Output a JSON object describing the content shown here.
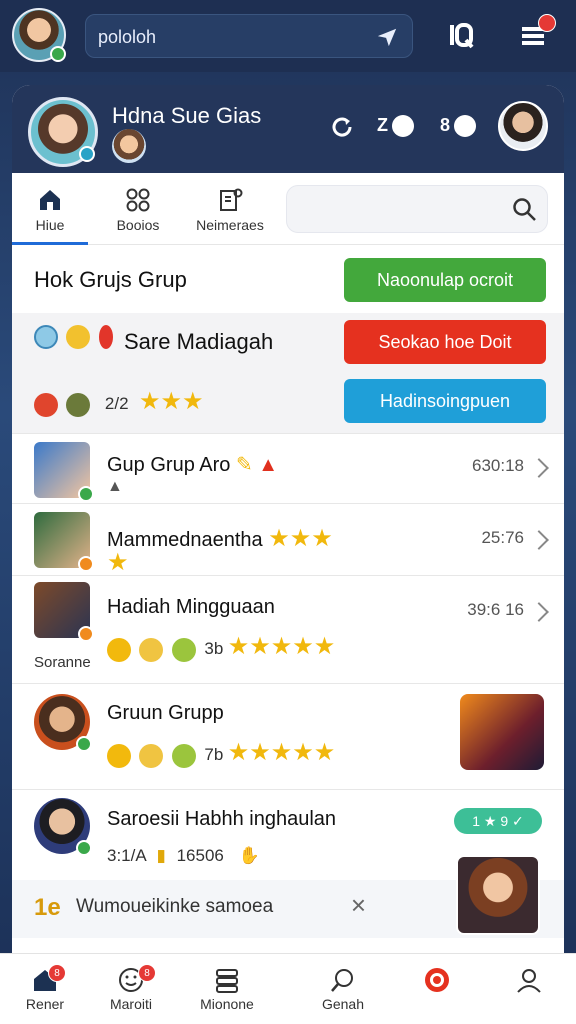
{
  "top": {
    "search_text": "pololoh"
  },
  "profile": {
    "name": "Hdna Sue Gias",
    "stat1": "Z",
    "stat2": "8"
  },
  "tabs": [
    {
      "label": "Hiue"
    },
    {
      "label": "Booios"
    },
    {
      "label": "Neimeraes"
    }
  ],
  "section": {
    "title": "Hok Grujs Grup",
    "btn_green": "Naoonulap ocroit",
    "row2_title": "Sare Madiagah",
    "btn_red": "Seokao hoe Doit",
    "rating_prefix": "2/2",
    "btn_blue": "Hadinsoingpuen"
  },
  "list": [
    {
      "title": "Gup Grup Aro",
      "meta": "630:18"
    },
    {
      "title": "Mammednaentha",
      "meta": "25:76"
    },
    {
      "title": "Hadiah Mingguaan",
      "meta": "39:6 16",
      "sub_num": "3b",
      "side_label": "Soranne"
    },
    {
      "title": "Gruun Grupp",
      "sub_num": "7b"
    },
    {
      "title": "Saroesii Habhh inghaulan",
      "sub_a": "3:1/A",
      "sub_b": "16506",
      "pill": "1 ★ 9 ✓"
    }
  ],
  "notice": {
    "icon_text": "1e",
    "text": "Wumoueikinke samoea"
  },
  "bottom_nav": [
    {
      "label": "Rener",
      "badge": "8"
    },
    {
      "label": "Maroiti",
      "badge": "8"
    },
    {
      "label": "Mionone"
    },
    {
      "label": "Genah"
    },
    {
      "label": ""
    },
    {
      "label": ""
    }
  ],
  "colors": {
    "green": "#43a83c",
    "red": "#e5311f",
    "blue": "#1f9fd8",
    "header": "#24365b"
  }
}
